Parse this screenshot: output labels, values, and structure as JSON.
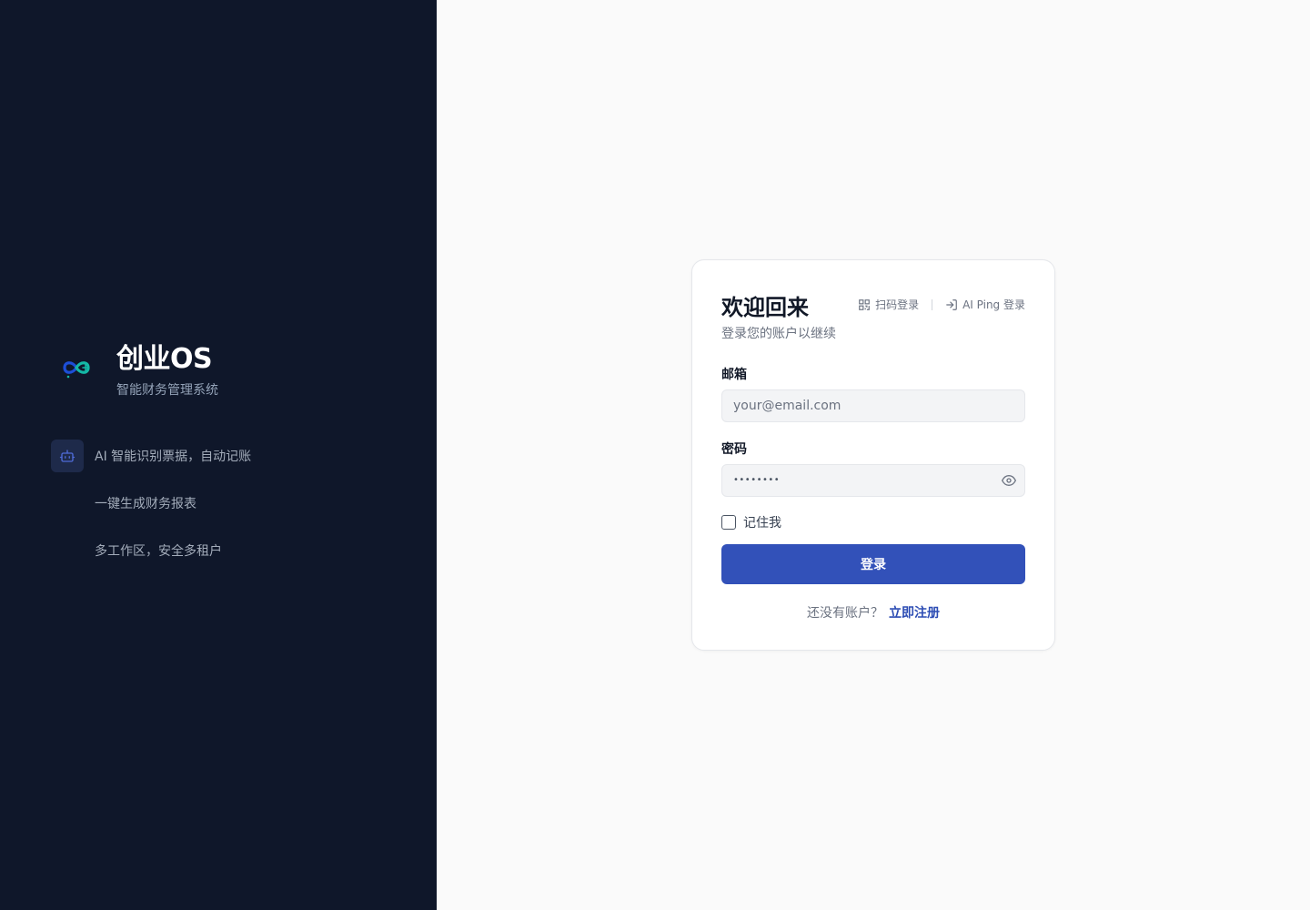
{
  "brand": {
    "title": "创业OS",
    "subtitle": "智能财务管理系统",
    "logo_icon": "infinity-logo-icon"
  },
  "features": [
    {
      "label": "AI 智能识别票据，自动记账",
      "icon": "robot-icon"
    },
    {
      "label": "一键生成财务报表",
      "icon": ""
    },
    {
      "label": "多工作区，安全多租户",
      "icon": ""
    }
  ],
  "login": {
    "title": "欢迎回来",
    "subtitle": "登录您的账户以继续",
    "alt_logins": {
      "qr_label": "扫码登录",
      "qr_icon": "qr-code-icon",
      "aiping_label": "AI Ping 登录",
      "aiping_icon": "login-arrow-icon"
    },
    "email": {
      "label": "邮箱",
      "placeholder": "your@email.com",
      "value": ""
    },
    "password": {
      "label": "密码",
      "masked_value": "••••••••",
      "toggle_icon": "eye-icon"
    },
    "remember_label": "记住我",
    "remember_checked": false,
    "submit_label": "登录",
    "signup_prompt": "还没有账户？",
    "signup_link": "立即注册"
  },
  "colors": {
    "sidebar_bg": "#0f172a",
    "page_bg": "#fafafa",
    "primary": "#3251b9",
    "link": "#2d4db4",
    "logo_blue": "#1d4ed8",
    "logo_teal": "#14b8a6"
  }
}
